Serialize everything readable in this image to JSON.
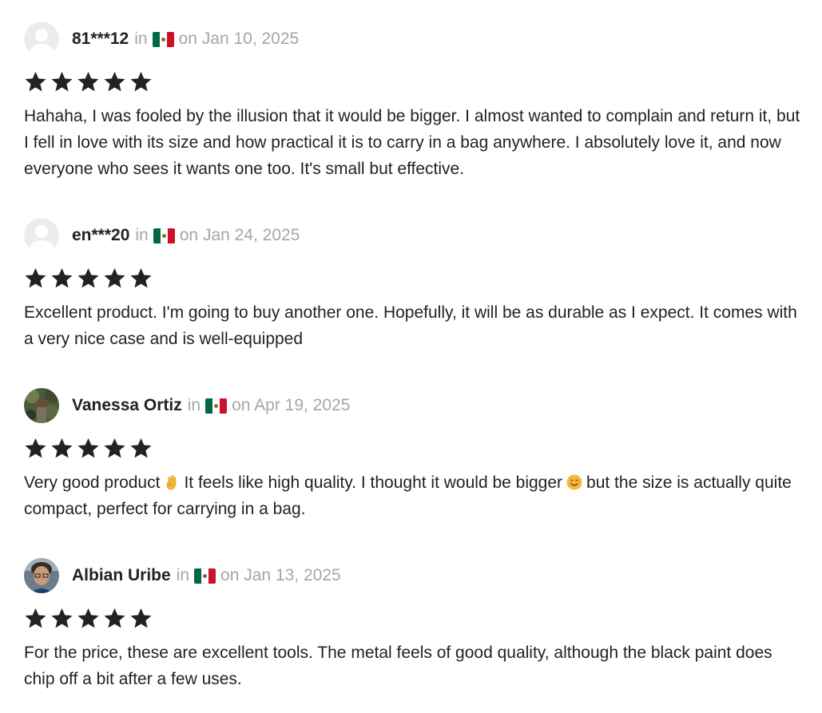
{
  "reviews": [
    {
      "author": "81***12",
      "in_label": "in",
      "country_flag": "mexico-flag-icon",
      "date": "on Jan 10, 2025",
      "avatar": "default-avatar-icon",
      "rating": 5,
      "text": "Hahaha, I was fooled by the illusion that it would be bigger. I almost wanted to complain and return it, but I fell in love with its size and how practical it is to carry in a bag anywhere. I absolutely love it, and now everyone who sees it wants one too. It's small but effective."
    },
    {
      "author": "en***20",
      "in_label": "in",
      "country_flag": "mexico-flag-icon",
      "date": "on Jan 24, 2025",
      "avatar": "default-avatar-icon",
      "rating": 5,
      "text": "Excellent product. I'm going to buy another one. Hopefully, it will be as durable as I expect. It comes with a very nice case and is well-equipped"
    },
    {
      "author": "Vanessa Ortiz",
      "in_label": "in",
      "country_flag": "mexico-flag-icon",
      "date": "on Apr 19, 2025",
      "avatar": "photo-avatar",
      "rating": 5,
      "text_part1": "Very good product",
      "emoji1": "ok-hand-emoji",
      "text_part2": "It feels like high quality. I thought it would be bigger",
      "emoji2": "smiling-face-emoji",
      "text_part3": "but the size is actually quite compact, perfect for carrying in a bag."
    },
    {
      "author": "Albian Uribe",
      "in_label": "in",
      "country_flag": "mexico-flag-icon",
      "date": "on Jan 13, 2025",
      "avatar": "photo-avatar",
      "rating": 5,
      "text": "For the price, these are excellent tools. The metal feels of good quality, although the black paint does chip off a bit after a few uses."
    }
  ],
  "colors": {
    "text": "#222222",
    "muted": "#a6a6a6",
    "star": "#222222"
  }
}
